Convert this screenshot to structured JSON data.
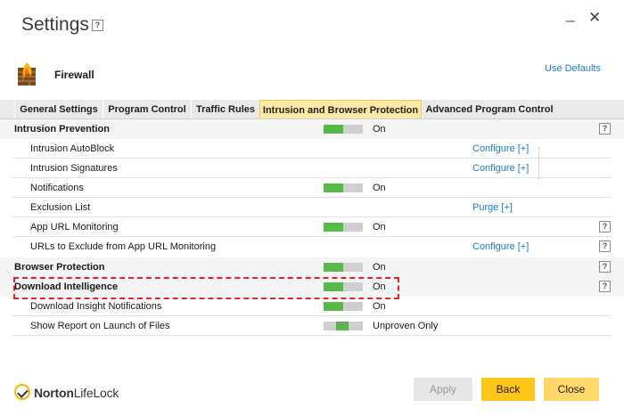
{
  "window": {
    "title": "Settings",
    "help_label": "?",
    "minimize_label": "_",
    "close_label": "✕"
  },
  "header": {
    "section": "Firewall",
    "use_defaults": "Use Defaults",
    "icon": "firewall-icon"
  },
  "tabs": [
    {
      "label": "General Settings",
      "active": false
    },
    {
      "label": "Program Control",
      "active": false
    },
    {
      "label": "Traffic Rules",
      "active": false
    },
    {
      "label": "Intrusion and Browser Protection",
      "active": true
    },
    {
      "label": "Advanced Program Control",
      "active": false
    }
  ],
  "rows": [
    {
      "label": "Intrusion Prevention",
      "state": "On",
      "help": "?"
    },
    {
      "label": "Intrusion AutoBlock",
      "link": "Configure [+]"
    },
    {
      "label": "Intrusion Signatures",
      "link": "Configure [+]"
    },
    {
      "label": "Notifications",
      "state": "On"
    },
    {
      "label": "Exclusion List",
      "link": "Purge [+]"
    },
    {
      "label": "App URL Monitoring",
      "state": "On",
      "help": "?"
    },
    {
      "label": "URLs to Exclude from App URL Monitoring",
      "link": "Configure [+]",
      "help": "?"
    },
    {
      "label": "Browser Protection",
      "state": "On",
      "help": "?"
    },
    {
      "label": "Download Intelligence",
      "state": "On",
      "help": "?"
    },
    {
      "label": "Download Insight Notifications",
      "state": "On"
    },
    {
      "label": "Show Report on Launch of Files",
      "state": "Unproven Only"
    }
  ],
  "footer": {
    "logo_text_bold": "Norton",
    "logo_text_rest": "LifeLock",
    "apply_label": "Apply",
    "back_label": "Back",
    "close_label": "Close"
  },
  "colors": {
    "toggle_on": "#56b948",
    "active_tab": "#fbe9a3",
    "link": "#1a7ac9",
    "highlight": "#e8202a",
    "back_button": "#ffc61a",
    "close_button": "#ffd86a"
  }
}
